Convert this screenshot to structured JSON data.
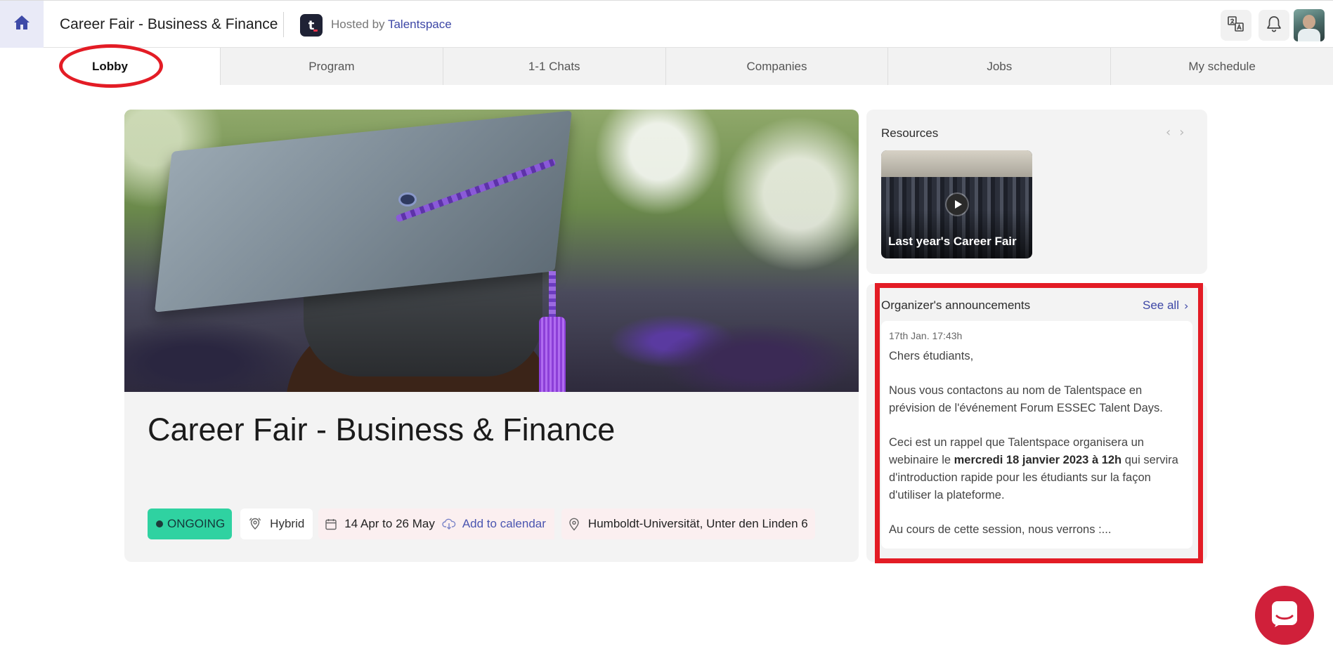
{
  "header": {
    "event_title": "Career Fair - Business & Finance",
    "host_logo_letter": "t",
    "hosted_by_prefix": "Hosted by",
    "host_name": "Talentspace",
    "icons": [
      "home-icon",
      "translate-icon",
      "bell-icon"
    ]
  },
  "nav": {
    "tabs": [
      {
        "label": "Lobby",
        "active": true
      },
      {
        "label": "Program",
        "active": false
      },
      {
        "label": "1-1 Chats",
        "active": false
      },
      {
        "label": "Companies",
        "active": false
      },
      {
        "label": "Jobs",
        "active": false
      },
      {
        "label": "My schedule",
        "active": false
      }
    ]
  },
  "hero": {
    "title": "Career Fair - Business & Finance",
    "status": "ONGOING",
    "format": "Hybrid",
    "dates": "14 Apr to 26 May",
    "add_to_calendar": "Add to calendar",
    "location": "Humboldt-Universität, Unter den Linden 6"
  },
  "resources": {
    "title": "Resources",
    "prev_arrow": "‹",
    "next_arrow": "›",
    "items": [
      {
        "caption": "Last year's Career Fair",
        "type": "video"
      }
    ]
  },
  "announcements": {
    "title": "Organizer's announcements",
    "see_all": "See all",
    "timestamp": "17th Jan. 17:43h",
    "greeting": "Chers étudiants,",
    "para1": "Nous vous contactons au nom de Talentspace  en prévision de l'événement Forum ESSEC Talent Days.",
    "para2_before": "Ceci est un rappel que Talentspace organisera un webinaire le ",
    "para2_bold": "mercredi 18 janvier 2023 à 12h",
    "para2_after": " qui servira d'introduction rapide pour les étudiants sur la façon d'utiliser la plateforme.",
    "para3": "Au cours de cette session, nous verrons :..."
  },
  "colors": {
    "accent": "#3d47a6",
    "status_green": "#2fd2a1",
    "highlight_red": "#e31c25",
    "chat_red": "#d0203a"
  }
}
